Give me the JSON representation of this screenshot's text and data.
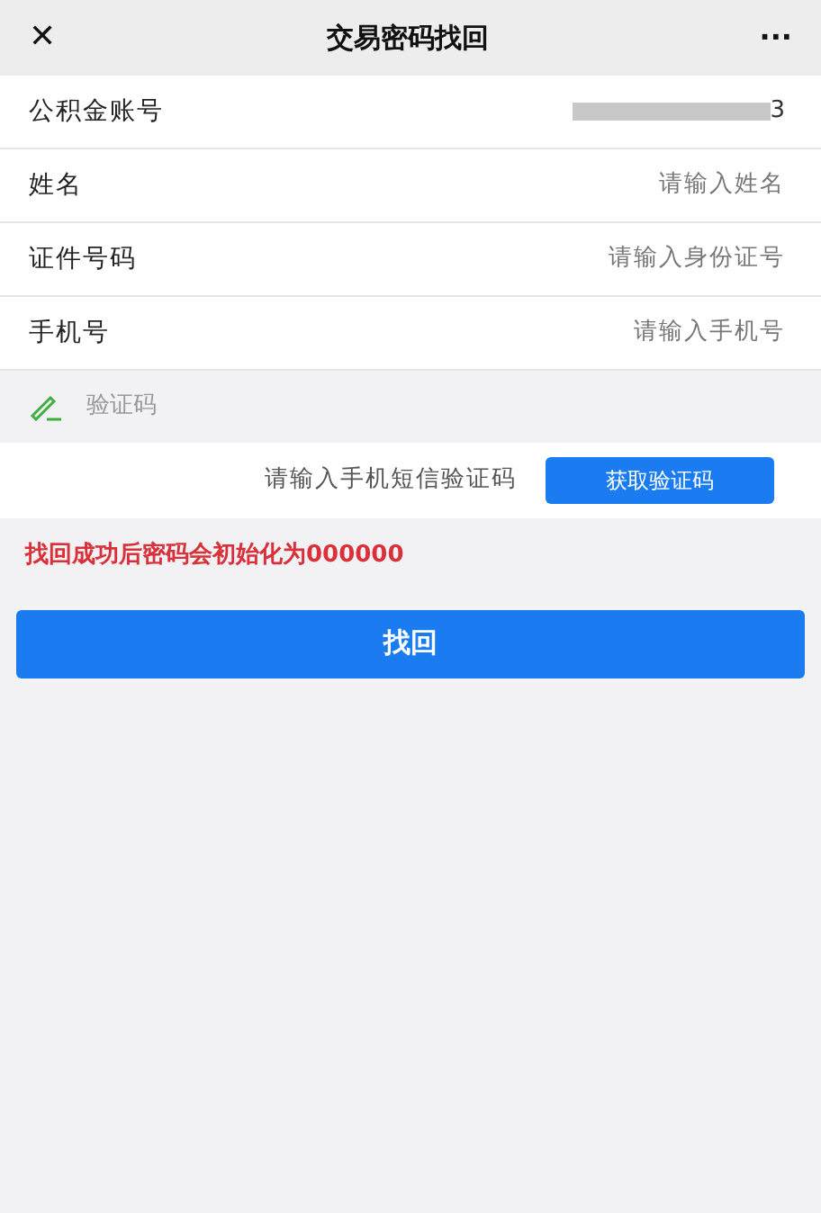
{
  "window": {
    "title": "交易密码找回",
    "close": "✕",
    "more": "···"
  },
  "fields": [
    {
      "label": "公积金账号",
      "value": "3",
      "redacted": true
    },
    {
      "label": "姓名",
      "placeholder": "请输入姓名"
    },
    {
      "label": "证件号码",
      "placeholder": "请输入身份证号"
    },
    {
      "label": "手机号",
      "placeholder": "请输入手机号"
    }
  ],
  "code_section": {
    "title": "验证码",
    "placeholder": "请输入手机短信验证码",
    "button": "获取验证码"
  },
  "notice": "找回成功后密码会初始化为000000",
  "submit": "找回"
}
